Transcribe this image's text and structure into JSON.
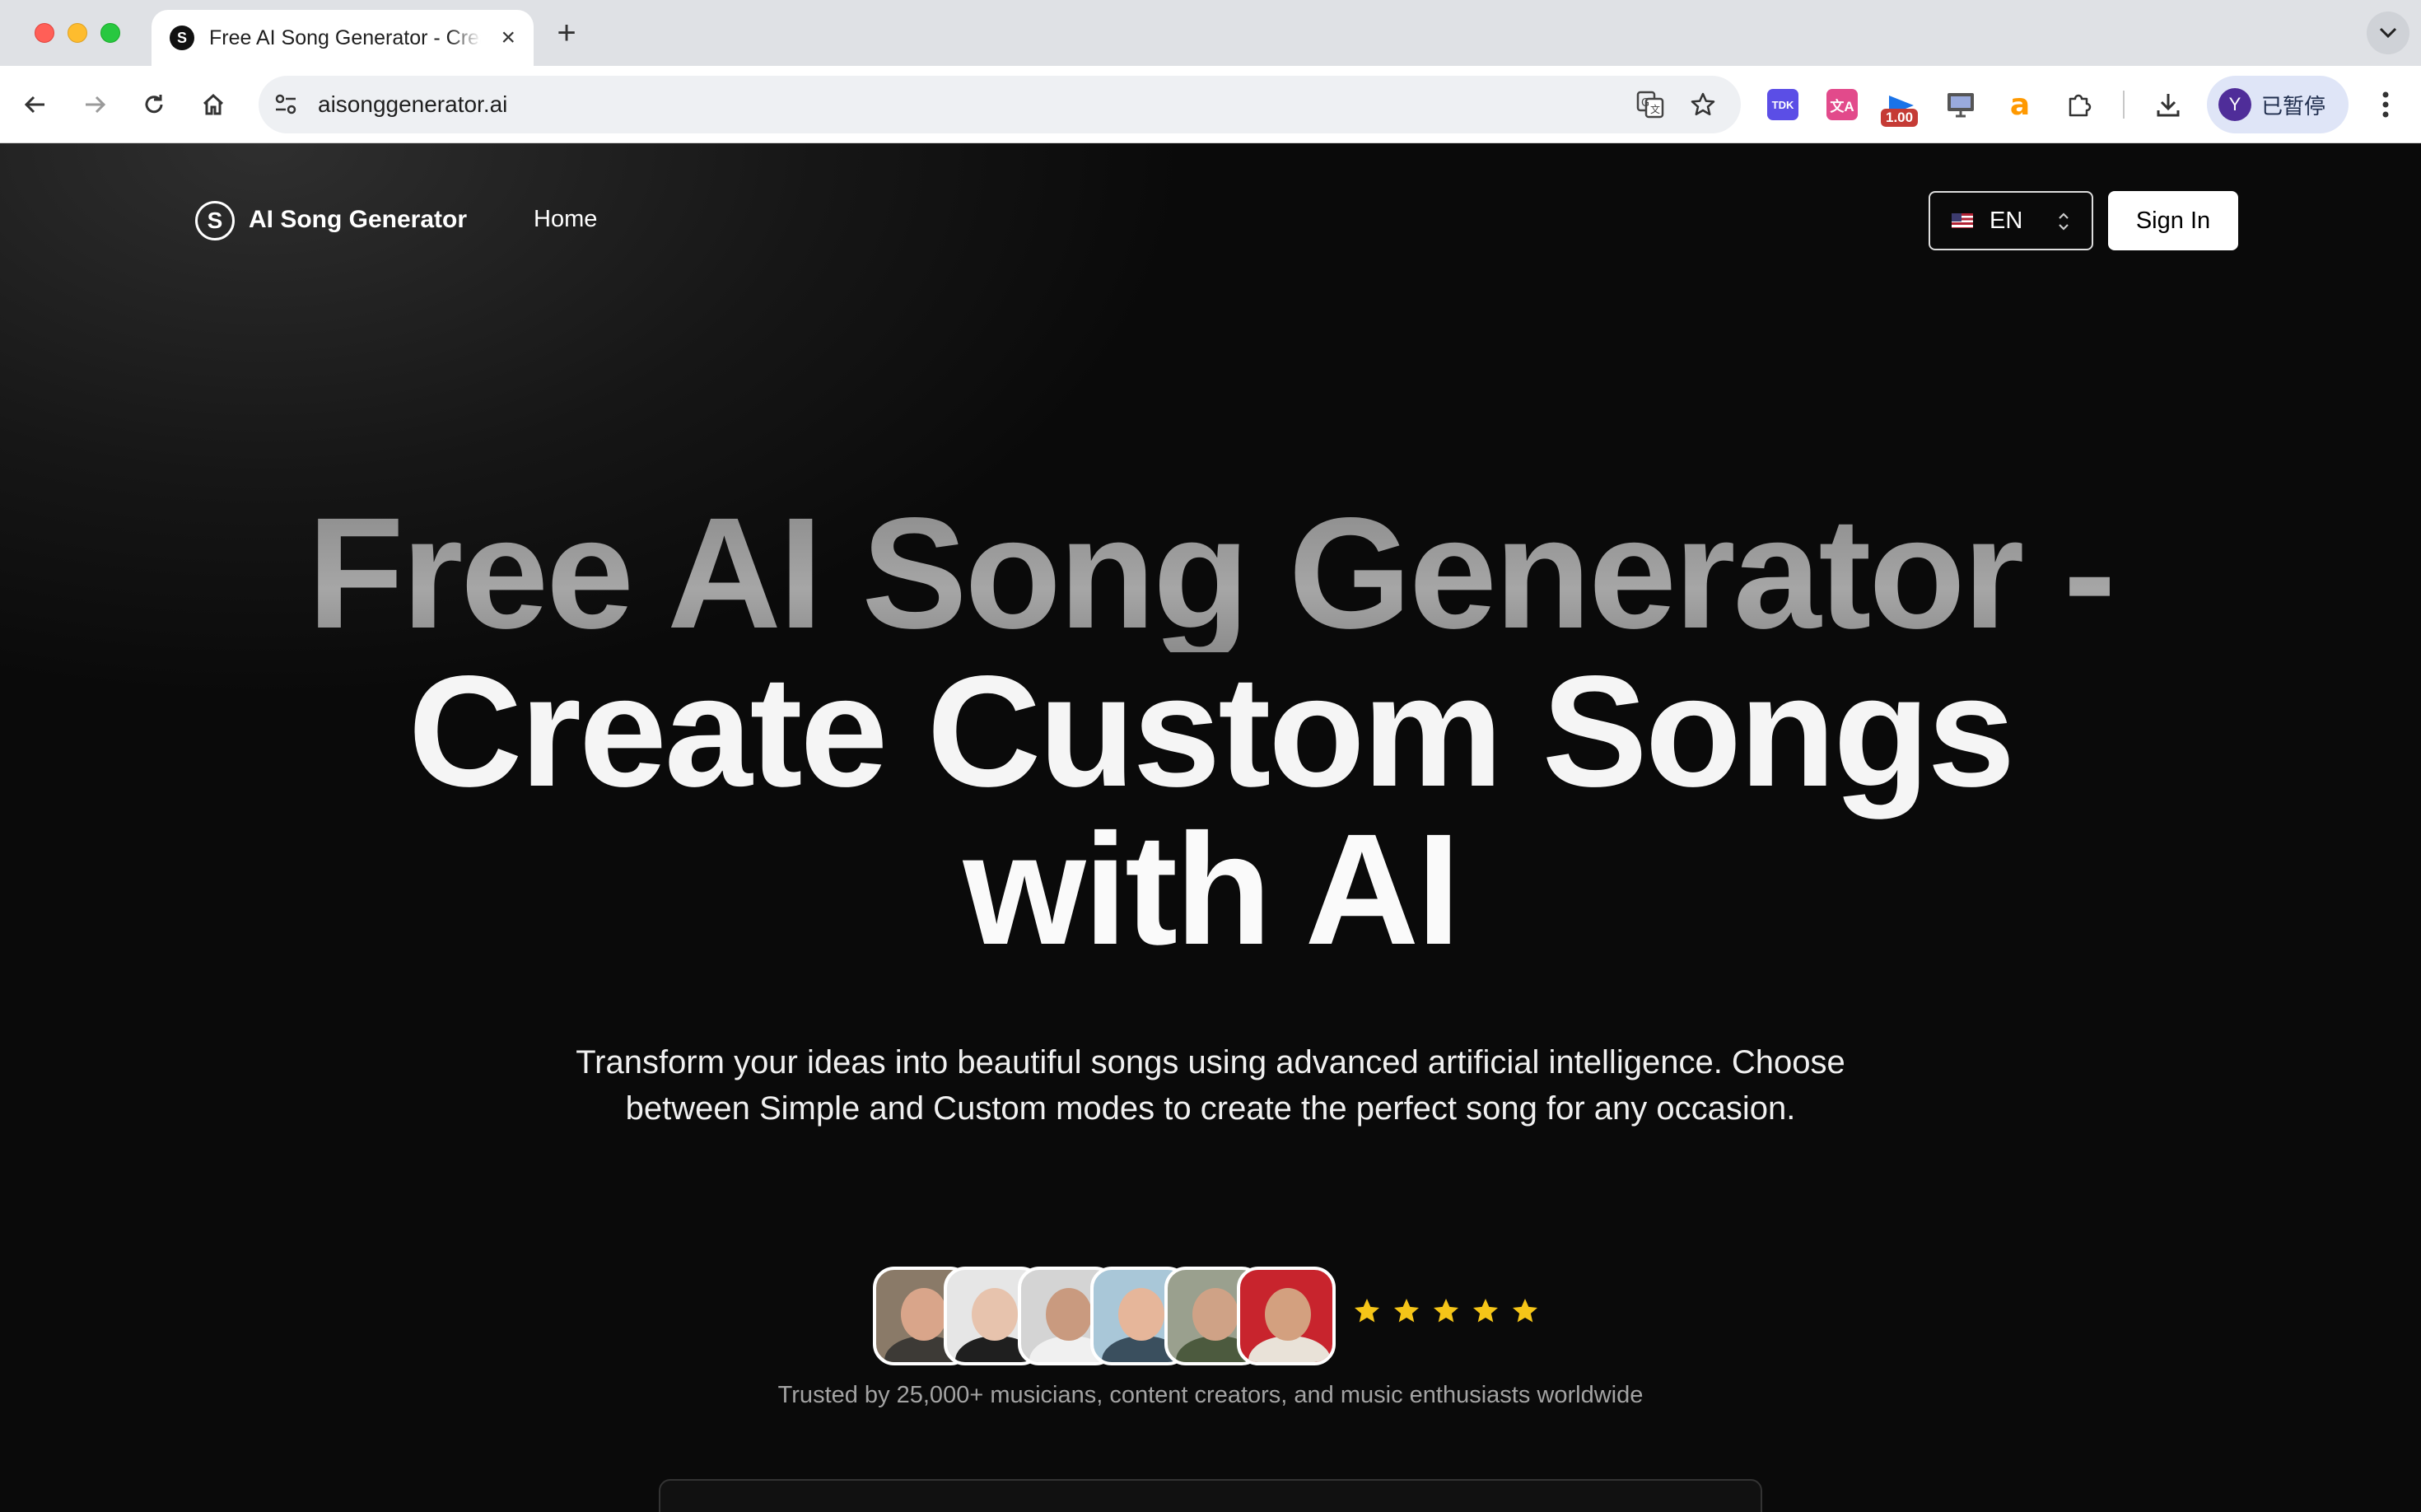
{
  "browser": {
    "tab": {
      "title": "Free AI Song Generator - Create Custom Songs with AI",
      "favicon_letter": "S"
    },
    "url": "aisonggenerator.ai",
    "extensions": [
      {
        "name": "tdk-extension",
        "label": "TDK",
        "color": "#5b4ee6"
      },
      {
        "name": "translate-extension",
        "label": "文A",
        "color": "#e24a8b"
      },
      {
        "name": "video-speed-extension",
        "badge": "1.00",
        "color": "#1a73e8"
      },
      {
        "name": "monitor-extension",
        "color": "#555555"
      },
      {
        "name": "amazon-extension",
        "label": "a",
        "color": "#ff9900"
      }
    ],
    "profile": {
      "initial": "Y",
      "label": "已暂停"
    }
  },
  "site": {
    "logo_letter": "S",
    "brand": "AI Song Generator",
    "nav": {
      "home": "Home"
    },
    "language": {
      "code": "EN"
    },
    "sign_in": "Sign In"
  },
  "hero": {
    "line1": "Free AI Song Generator -",
    "line2": "Create Custom Songs",
    "line3": "with AI",
    "subtitle": "Transform your ideas into beautiful songs using advanced artificial intelligence. Choose between Simple and Custom modes to create the perfect song for any occasion.",
    "rating_stars": 5,
    "trust_text": "Trusted by 25,000+ musicians, content creators, and music enthusiasts worldwide"
  },
  "colors": {
    "accent_star": "#f5c518",
    "page_bg": "#0a0a0a"
  }
}
